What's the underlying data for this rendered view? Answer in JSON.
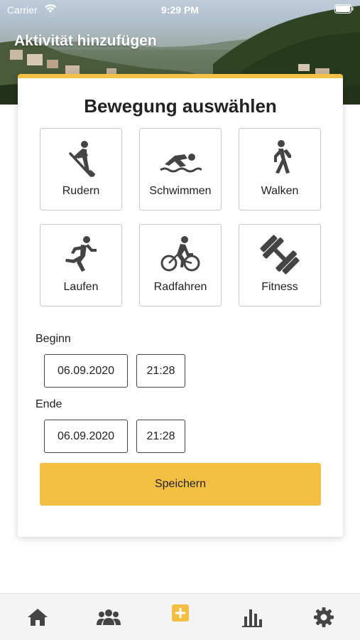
{
  "status_bar": {
    "carrier": "Carrier",
    "time": "9:29 PM"
  },
  "header": {
    "title": "Aktivität hinzufügen"
  },
  "card": {
    "title": "Bewegung auswählen",
    "activities": [
      {
        "label": "Rudern",
        "icon": "rowing-icon"
      },
      {
        "label": "Schwimmen",
        "icon": "swimming-icon"
      },
      {
        "label": "Walken",
        "icon": "walking-icon"
      },
      {
        "label": "Laufen",
        "icon": "running-icon"
      },
      {
        "label": "Radfahren",
        "icon": "cycling-icon"
      },
      {
        "label": "Fitness",
        "icon": "dumbbell-icon"
      }
    ],
    "start": {
      "label": "Beginn",
      "date": "06.09.2020",
      "time": "21:28"
    },
    "end": {
      "label": "Ende",
      "date": "06.09.2020",
      "time": "21:28"
    },
    "save_label": "Speichern"
  },
  "tab_bar": {
    "tabs": [
      {
        "icon": "home-icon",
        "active": false
      },
      {
        "icon": "group-icon",
        "active": false
      },
      {
        "icon": "add-icon",
        "active": true
      },
      {
        "icon": "statistics-icon",
        "active": false
      },
      {
        "icon": "settings-icon",
        "active": false
      }
    ]
  },
  "colors": {
    "accent": "#f2bf43",
    "icon": "#444444",
    "tab_background": "#f4f4f4"
  }
}
